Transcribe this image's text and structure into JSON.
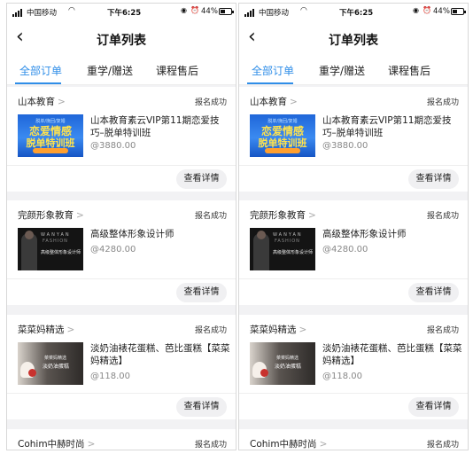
{
  "status_bar": {
    "carrier": "中国移动",
    "time": "下午6:25",
    "battery": "44%"
  },
  "header": {
    "title": "订单列表"
  },
  "tabs": [
    {
      "label": "全部订单",
      "active": true
    },
    {
      "label": "重学/赠送",
      "active": false
    },
    {
      "label": "课程售后",
      "active": false
    }
  ],
  "orders": [
    {
      "shop": "山本教育",
      "status": "报名成功",
      "product": "山本教育素云VIP第11期恋爱技巧–脱单特训班",
      "price": "@3880.00",
      "button": "查看详情",
      "thumb": {
        "line1": "脱单/挽回/复婚",
        "line2": "恋爱情感",
        "line3": "脱单特训班"
      }
    },
    {
      "shop": "完颜形象教育",
      "status": "报名成功",
      "product": "高级整体形象设计师",
      "price": "@4280.00",
      "button": "查看详情",
      "thumb": {
        "line1": "WANYAN",
        "line2": "FASHION",
        "line3": "高级整体形象设计师"
      }
    },
    {
      "shop": "菜菜妈精选",
      "status": "报名成功",
      "product": "淡奶油裱花蛋糕、芭比蛋糕【菜菜妈精选】",
      "price": "@118.00",
      "button": "查看详情",
      "thumb": {
        "line1": "菜菜妈精选",
        "line2": "淡奶油蛋糕"
      }
    },
    {
      "shop": "Cohim中赫时尚",
      "status": "报名成功"
    }
  ],
  "colors": {
    "accent": "#2f8ee8",
    "background": "#f2f2f4"
  }
}
